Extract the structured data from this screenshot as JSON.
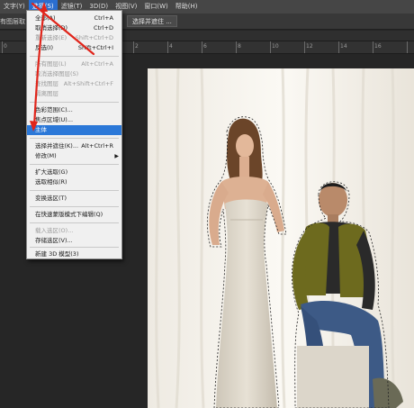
{
  "menubar": {
    "items": [
      {
        "label": "文字(Y)",
        "active": false
      },
      {
        "label": "选择(S)",
        "active": true
      },
      {
        "label": "滤镜(T)",
        "active": false
      },
      {
        "label": "3D(D)",
        "active": false
      },
      {
        "label": "视图(V)",
        "active": false
      },
      {
        "label": "窗口(W)",
        "active": false
      },
      {
        "label": "帮助(H)",
        "active": false
      }
    ]
  },
  "options": {
    "left_text": "有图层取",
    "select_mask_button": "选择并遮住 ..."
  },
  "ruler": {
    "ticks": [
      "0",
      "2",
      "4",
      "6",
      "8",
      "10",
      "12",
      "14",
      "16"
    ]
  },
  "select_menu": {
    "items": [
      {
        "label": "全部(A)",
        "shortcut": "Ctrl+A",
        "disabled": false
      },
      {
        "label": "取消选择(D)",
        "shortcut": "Ctrl+D",
        "disabled": false
      },
      {
        "label": "重新选择(E)",
        "shortcut": "Shift+Ctrl+D",
        "disabled": true
      },
      {
        "label": "反选(I)",
        "shortcut": "Shift+Ctrl+I",
        "disabled": false
      },
      {
        "label": "所有图层(L)",
        "shortcut": "Alt+Ctrl+A",
        "disabled": true
      },
      {
        "label": "取消选择图层(S)",
        "shortcut": "",
        "disabled": true
      },
      {
        "label": "查找图层",
        "shortcut": "Alt+Shift+Ctrl+F",
        "disabled": true
      },
      {
        "label": "隔离图层",
        "shortcut": "",
        "disabled": true
      },
      {
        "label": "色彩范围(C)...",
        "shortcut": "",
        "disabled": false
      },
      {
        "label": "焦点区域(U)...",
        "shortcut": "",
        "disabled": false
      },
      {
        "label": "主体",
        "shortcut": "",
        "disabled": false,
        "highlight": true
      },
      {
        "label": "选择并遮住(K)...",
        "shortcut": "Alt+Ctrl+R",
        "disabled": false
      },
      {
        "label": "修改(M)",
        "shortcut": "",
        "disabled": false,
        "submenu": true
      },
      {
        "label": "扩大选取(G)",
        "shortcut": "",
        "disabled": false
      },
      {
        "label": "选取相似(R)",
        "shortcut": "",
        "disabled": false
      },
      {
        "label": "变换选区(T)",
        "shortcut": "",
        "disabled": false
      },
      {
        "label": "在快速蒙版模式下编辑(Q)",
        "shortcut": "",
        "disabled": false
      },
      {
        "label": "载入选区(O)...",
        "shortcut": "",
        "disabled": true
      },
      {
        "label": "存储选区(V)...",
        "shortcut": "",
        "disabled": false
      },
      {
        "label": "新建 3D 模型(3)",
        "shortcut": "",
        "disabled": false
      }
    ]
  },
  "colors": {
    "accent": "#2b78d8",
    "annotation_arrow": "#e0251b"
  }
}
